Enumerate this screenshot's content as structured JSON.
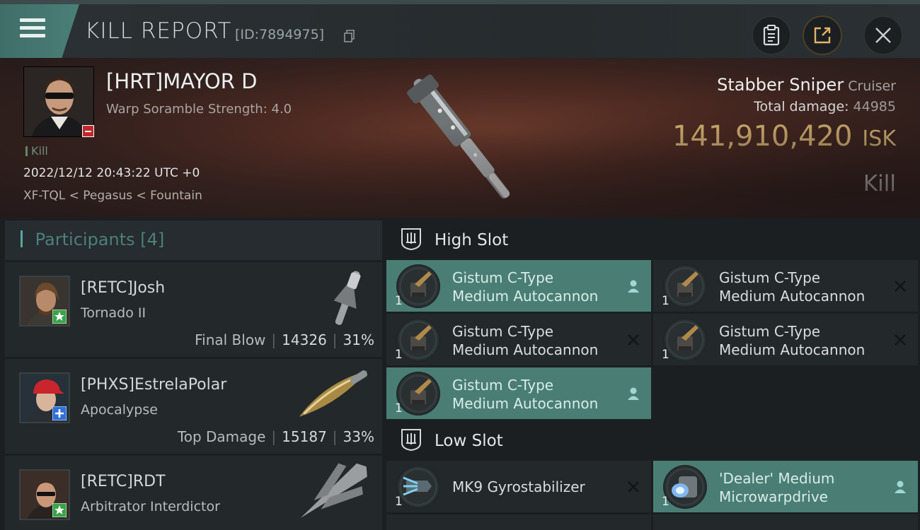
{
  "header": {
    "title": "KILL REPORT",
    "report_id": "[ID:7894975]"
  },
  "victim": {
    "name": "[HRT]MAYOR D",
    "subline": "Warp Soramble Strength: 4.0",
    "tag": "Kill",
    "timestamp": "2022/12/12 20:43:22 UTC +0",
    "location": "XF-TQL < Pegasus < Fountain",
    "ship_name": "Stabber Sniper",
    "ship_class": "Cruiser",
    "total_damage_label": "Total damage:",
    "total_damage_value": "44985",
    "isk_value": "141,910,420",
    "isk_unit": "ISK",
    "result": "Kill"
  },
  "participants": {
    "label": "Participants",
    "count": "[4]",
    "rows": [
      {
        "name": "[RETC]Josh",
        "ship": "Tornado II",
        "stat_label": "Final Blow",
        "damage": "14326",
        "percent": "31%"
      },
      {
        "name": "[PHXS]EstrelaPolar",
        "ship": "Apocalypse",
        "stat_label": "Top Damage",
        "damage": "15187",
        "percent": "33%"
      },
      {
        "name": "[RETC]RDT",
        "ship": "Arbitrator Interdictor",
        "stat_label": "",
        "damage": "",
        "percent": ""
      }
    ]
  },
  "high_slot": {
    "title": "High Slot",
    "modules": [
      {
        "qty": "1",
        "line1": "Gistum C-Type",
        "line2": "Medium Autocannon",
        "state": "dropped"
      },
      {
        "qty": "1",
        "line1": "Gistum C-Type",
        "line2": "Medium Autocannon",
        "state": "destroyed"
      },
      {
        "qty": "1",
        "line1": "Gistum C-Type",
        "line2": "Medium Autocannon",
        "state": "destroyed"
      },
      {
        "qty": "1",
        "line1": "Gistum C-Type",
        "line2": "Medium Autocannon",
        "state": "destroyed"
      },
      {
        "qty": "1",
        "line1": "Gistum C-Type",
        "line2": "Medium Autocannon",
        "state": "dropped"
      }
    ]
  },
  "low_slot": {
    "title": "Low Slot",
    "modules": [
      {
        "qty": "1",
        "line1": "MK9 Gyrostabilizer",
        "line2": "",
        "state": "destroyed"
      },
      {
        "qty": "1",
        "line1": "'Dealer' Medium",
        "line2": "Microwarpdrive",
        "state": "dropped"
      }
    ]
  },
  "colors": {
    "accent_teal": "#4a7e75",
    "isk_gold": "#e6c27a",
    "loss_red": "#c0282d",
    "friend_green": "#3aa34a",
    "friend_blue": "#2f6fd8"
  }
}
